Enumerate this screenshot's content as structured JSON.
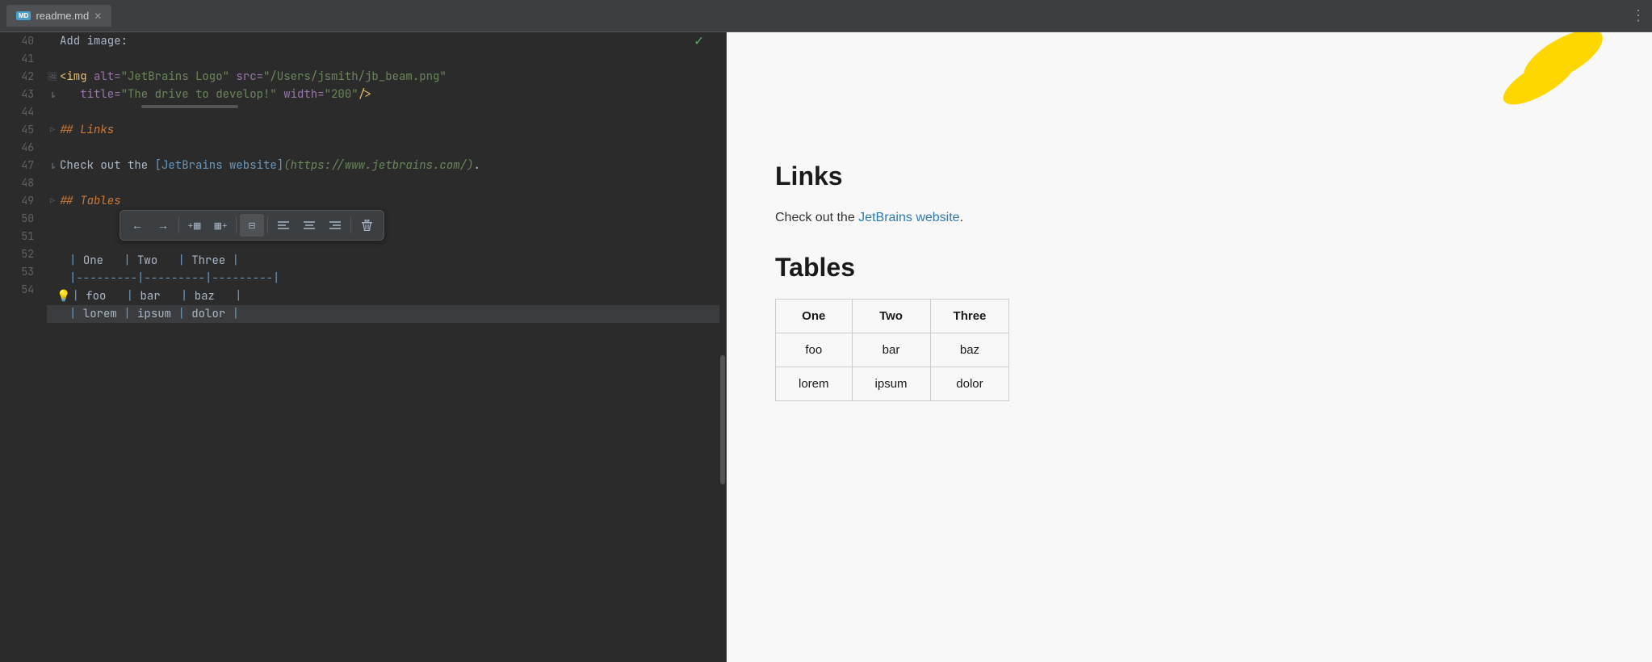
{
  "titlebar": {
    "tab_name": "readme.md",
    "tab_icon": "MD",
    "more_icon": "⋮"
  },
  "editor": {
    "lines": [
      {
        "num": "40",
        "content": "add_image",
        "type": "plain",
        "text": "Add image:"
      },
      {
        "num": "41",
        "content": "blank",
        "type": "blank"
      },
      {
        "num": "42",
        "content": "img_tag",
        "type": "img"
      },
      {
        "num": "",
        "content": "img_tag_cont",
        "type": "img_cont"
      },
      {
        "num": "43",
        "content": "blank",
        "type": "blank"
      },
      {
        "num": "44",
        "content": "links_heading",
        "type": "heading",
        "text": "## Links"
      },
      {
        "num": "45",
        "content": "blank",
        "type": "blank"
      },
      {
        "num": "46",
        "content": "link_line",
        "type": "link"
      },
      {
        "num": "47",
        "content": "blank",
        "type": "blank"
      },
      {
        "num": "48",
        "content": "tables_heading",
        "type": "heading",
        "text": "## Tables"
      },
      {
        "num": "49",
        "content": "blank",
        "type": "blank"
      },
      {
        "num": "50",
        "content": "table_header",
        "type": "table_header"
      },
      {
        "num": "51",
        "content": "table_sep",
        "type": "table_sep"
      },
      {
        "num": "52",
        "content": "table_row1",
        "type": "table_row1"
      },
      {
        "num": "53",
        "content": "table_row2",
        "type": "table_row2"
      },
      {
        "num": "54",
        "content": "blank",
        "type": "blank"
      }
    ],
    "toolbar": {
      "buttons": [
        {
          "id": "arrow-left",
          "icon": "←",
          "tooltip": "Move column left"
        },
        {
          "id": "arrow-right",
          "icon": "→",
          "tooltip": "Move column right"
        },
        {
          "id": "add-col-left",
          "icon": "+◫",
          "tooltip": "Add column before"
        },
        {
          "id": "add-col-right",
          "icon": "◫+",
          "tooltip": "Add column after"
        },
        {
          "id": "remove-col",
          "icon": "⊟",
          "tooltip": "Remove column"
        },
        {
          "id": "align-left",
          "icon": "≡",
          "tooltip": "Align left"
        },
        {
          "id": "align-center",
          "icon": "≡",
          "tooltip": "Align center"
        },
        {
          "id": "align-right",
          "icon": "≡",
          "tooltip": "Align right"
        },
        {
          "id": "delete",
          "icon": "🗑",
          "tooltip": "Delete table"
        }
      ]
    }
  },
  "preview": {
    "links_heading": "Links",
    "links_text_prefix": "Check out the ",
    "links_link_text": "JetBrains website",
    "links_text_suffix": ".",
    "tables_heading": "Tables",
    "table": {
      "headers": [
        "One",
        "Two",
        "Three"
      ],
      "rows": [
        [
          "foo",
          "bar",
          "baz"
        ],
        [
          "lorem",
          "ipsum",
          "dolor"
        ]
      ]
    }
  }
}
